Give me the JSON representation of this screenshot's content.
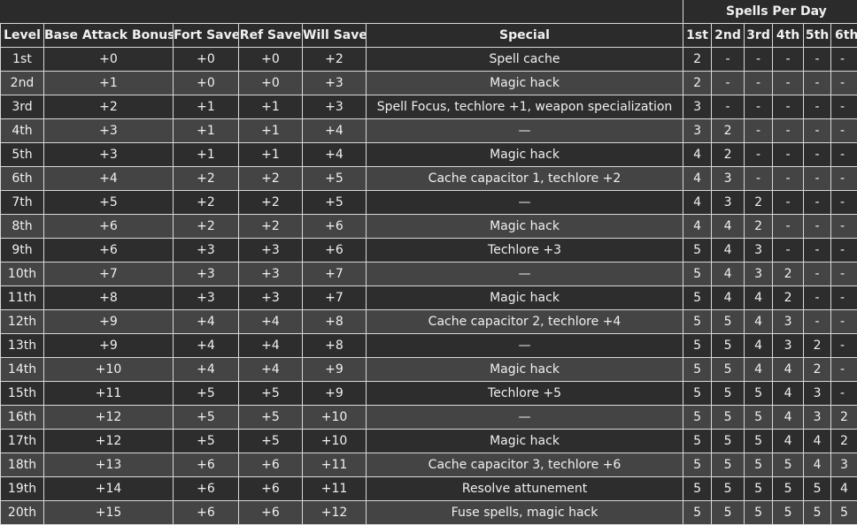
{
  "table": {
    "group_header": "Spells Per Day",
    "columns": [
      "Level",
      "Base Attack Bonus",
      "Fort Save",
      "Ref Save",
      "Will Save",
      "Special"
    ],
    "spell_columns": [
      "1st",
      "2nd",
      "3rd",
      "4th",
      "5th",
      "6th"
    ],
    "rows": [
      {
        "level": "1st",
        "bab": "+0",
        "fort": "+0",
        "ref": "+0",
        "will": "+2",
        "special": "Spell cache",
        "spells": [
          "2",
          "-",
          "-",
          "-",
          "-",
          "-"
        ]
      },
      {
        "level": "2nd",
        "bab": "+1",
        "fort": "+0",
        "ref": "+0",
        "will": "+3",
        "special": "Magic hack",
        "spells": [
          "2",
          "-",
          "-",
          "-",
          "-",
          "-"
        ]
      },
      {
        "level": "3rd",
        "bab": "+2",
        "fort": "+1",
        "ref": "+1",
        "will": "+3",
        "special": "Spell Focus, techlore +1, weapon specialization",
        "spells": [
          "3",
          "-",
          "-",
          "-",
          "-",
          "-"
        ]
      },
      {
        "level": "4th",
        "bab": "+3",
        "fort": "+1",
        "ref": "+1",
        "will": "+4",
        "special": "—",
        "spells": [
          "3",
          "2",
          "-",
          "-",
          "-",
          "-"
        ]
      },
      {
        "level": "5th",
        "bab": "+3",
        "fort": "+1",
        "ref": "+1",
        "will": "+4",
        "special": "Magic hack",
        "spells": [
          "4",
          "2",
          "-",
          "-",
          "-",
          "-"
        ]
      },
      {
        "level": "6th",
        "bab": "+4",
        "fort": "+2",
        "ref": "+2",
        "will": "+5",
        "special": "Cache capacitor 1, techlore +2",
        "spells": [
          "4",
          "3",
          "-",
          "-",
          "-",
          "-"
        ]
      },
      {
        "level": "7th",
        "bab": "+5",
        "fort": "+2",
        "ref": "+2",
        "will": "+5",
        "special": "—",
        "spells": [
          "4",
          "3",
          "2",
          "-",
          "-",
          "-"
        ]
      },
      {
        "level": "8th",
        "bab": "+6",
        "fort": "+2",
        "ref": "+2",
        "will": "+6",
        "special": "Magic hack",
        "spells": [
          "4",
          "4",
          "2",
          "-",
          "-",
          "-"
        ]
      },
      {
        "level": "9th",
        "bab": "+6",
        "fort": "+3",
        "ref": "+3",
        "will": "+6",
        "special": "Techlore +3",
        "spells": [
          "5",
          "4",
          "3",
          "-",
          "-",
          "-"
        ]
      },
      {
        "level": "10th",
        "bab": "+7",
        "fort": "+3",
        "ref": "+3",
        "will": "+7",
        "special": "—",
        "spells": [
          "5",
          "4",
          "3",
          "2",
          "-",
          "-"
        ]
      },
      {
        "level": "11th",
        "bab": "+8",
        "fort": "+3",
        "ref": "+3",
        "will": "+7",
        "special": "Magic hack",
        "spells": [
          "5",
          "4",
          "4",
          "2",
          "-",
          "-"
        ]
      },
      {
        "level": "12th",
        "bab": "+9",
        "fort": "+4",
        "ref": "+4",
        "will": "+8",
        "special": "Cache capacitor 2, techlore +4",
        "spells": [
          "5",
          "5",
          "4",
          "3",
          "-",
          "-"
        ]
      },
      {
        "level": "13th",
        "bab": "+9",
        "fort": "+4",
        "ref": "+4",
        "will": "+8",
        "special": "—",
        "spells": [
          "5",
          "5",
          "4",
          "3",
          "2",
          "-"
        ]
      },
      {
        "level": "14th",
        "bab": "+10",
        "fort": "+4",
        "ref": "+4",
        "will": "+9",
        "special": "Magic hack",
        "spells": [
          "5",
          "5",
          "4",
          "4",
          "2",
          "-"
        ]
      },
      {
        "level": "15th",
        "bab": "+11",
        "fort": "+5",
        "ref": "+5",
        "will": "+9",
        "special": "Techlore +5",
        "spells": [
          "5",
          "5",
          "5",
          "4",
          "3",
          "-"
        ]
      },
      {
        "level": "16th",
        "bab": "+12",
        "fort": "+5",
        "ref": "+5",
        "will": "+10",
        "special": "—",
        "spells": [
          "5",
          "5",
          "5",
          "4",
          "3",
          "2"
        ]
      },
      {
        "level": "17th",
        "bab": "+12",
        "fort": "+5",
        "ref": "+5",
        "will": "+10",
        "special": "Magic hack",
        "spells": [
          "5",
          "5",
          "5",
          "4",
          "4",
          "2"
        ]
      },
      {
        "level": "18th",
        "bab": "+13",
        "fort": "+6",
        "ref": "+6",
        "will": "+11",
        "special": "Cache capacitor 3, techlore +6",
        "spells": [
          "5",
          "5",
          "5",
          "5",
          "4",
          "3"
        ]
      },
      {
        "level": "19th",
        "bab": "+14",
        "fort": "+6",
        "ref": "+6",
        "will": "+11",
        "special": "Resolve attunement",
        "spells": [
          "5",
          "5",
          "5",
          "5",
          "5",
          "4"
        ]
      },
      {
        "level": "20th",
        "bab": "+15",
        "fort": "+6",
        "ref": "+6",
        "will": "+12",
        "special": "Fuse spells, magic hack",
        "spells": [
          "5",
          "5",
          "5",
          "5",
          "5",
          "5"
        ]
      }
    ]
  }
}
